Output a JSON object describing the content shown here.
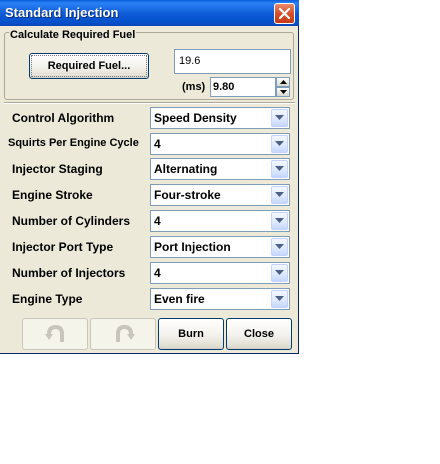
{
  "window": {
    "title": "Standard Injection"
  },
  "fuel_section": {
    "legend": "Calculate Required Fuel",
    "required_fuel_button": "Required Fuel...",
    "fuel_value": "19.6",
    "ms_label": "(ms)",
    "ms_value": "9.80"
  },
  "settings": [
    {
      "label": "Control Algorithm",
      "value": "Speed Density"
    },
    {
      "label": "Squirts Per Engine Cycle",
      "value": "4"
    },
    {
      "label": "Injector Staging",
      "value": "Alternating"
    },
    {
      "label": "Engine Stroke",
      "value": "Four-stroke"
    },
    {
      "label": "Number of Cylinders",
      "value": "4"
    },
    {
      "label": "Injector Port Type",
      "value": "Port Injection"
    },
    {
      "label": "Number of Injectors",
      "value": "4"
    },
    {
      "label": "Engine Type",
      "value": "Even fire"
    }
  ],
  "buttons": {
    "undo_icon": "undo-arrow-icon",
    "redo_icon": "redo-arrow-icon",
    "burn": "Burn",
    "close": "Close"
  },
  "colors": {
    "titlebar": "#0c5ad6",
    "dialog_bg": "#ece9d8",
    "close_button": "#d8502a"
  }
}
